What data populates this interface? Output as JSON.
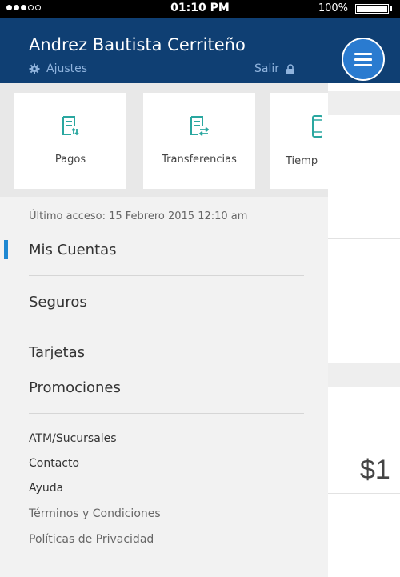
{
  "status_bar": {
    "time": "01:10 PM",
    "battery": "100%"
  },
  "header": {
    "user_name": "Andrez Bautista Cerriteño",
    "settings_label": "Ajustes",
    "logout_label": "Salir"
  },
  "shortcuts": [
    {
      "label": "Pagos",
      "icon": "payments-icon"
    },
    {
      "label": "Transferencias",
      "icon": "transfers-icon"
    },
    {
      "label": "Tiemp",
      "icon": "airtime-icon"
    }
  ],
  "last_access": "Último acceso: 15 Febrero 2015 12:10 am",
  "nav": {
    "items": [
      {
        "label": "Mis Cuentas",
        "active": true
      },
      {
        "label": "Seguros",
        "active": false
      },
      {
        "label": "Tarjetas",
        "active": false
      },
      {
        "label": "Promociones",
        "active": false
      }
    ]
  },
  "links": [
    {
      "label": "ATM/Sucursales"
    },
    {
      "label": "Contacto"
    },
    {
      "label": "Ayuda"
    },
    {
      "label": "Términos y Condiciones"
    },
    {
      "label": "Políticas de Privacidad"
    }
  ],
  "main": {
    "amount_partial": "$1"
  },
  "colors": {
    "header_bg": "#0f3f73",
    "accent": "#1e88d2",
    "menu_button": "#2a7bd0",
    "drawer_bg": "#f2f2f2"
  }
}
